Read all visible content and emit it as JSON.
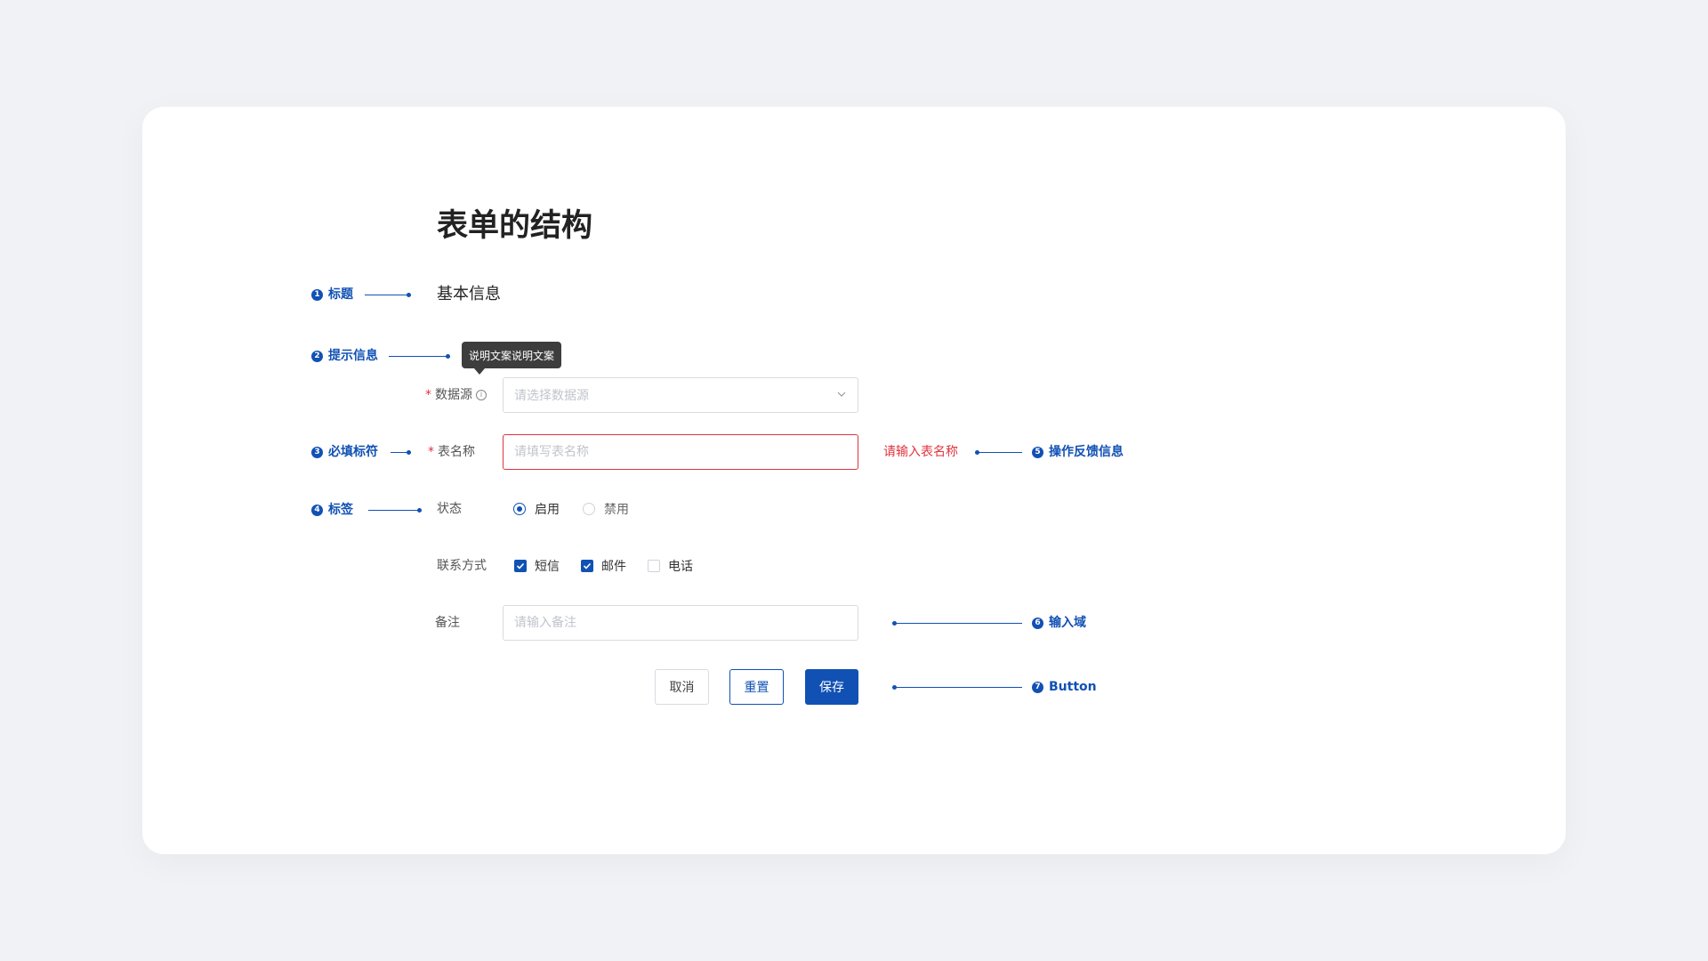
{
  "page": {
    "title": "表单的结构",
    "section_title": "基本信息"
  },
  "annotations": [
    {
      "num": "1",
      "label": "标题"
    },
    {
      "num": "2",
      "label": "提示信息"
    },
    {
      "num": "3",
      "label": "必填标符"
    },
    {
      "num": "4",
      "label": "标签"
    },
    {
      "num": "5",
      "label": "操作反馈信息"
    },
    {
      "num": "6",
      "label": "输入域"
    },
    {
      "num": "7",
      "label": "Button"
    }
  ],
  "tooltip": {
    "text": "说明文案说明文案"
  },
  "form": {
    "required_mark": "*",
    "datasource": {
      "label": "数据源",
      "placeholder": "请选择数据源",
      "info_icon": "i"
    },
    "table_name": {
      "label": "表名称",
      "placeholder": "请填写表名称",
      "error": "请输入表名称"
    },
    "status": {
      "label": "状态",
      "options": [
        "启用",
        "禁用"
      ],
      "selected": "启用"
    },
    "contact": {
      "label": "联系方式",
      "options": [
        {
          "label": "短信",
          "checked": true
        },
        {
          "label": "邮件",
          "checked": true
        },
        {
          "label": "电话",
          "checked": false
        }
      ]
    },
    "remark": {
      "label": "备注",
      "placeholder": "请输入备注"
    }
  },
  "buttons": {
    "cancel": "取消",
    "reset": "重置",
    "save": "保存"
  },
  "colors": {
    "accent": "#1151b4",
    "error": "#e0343f",
    "background": "#f0f2f5"
  }
}
